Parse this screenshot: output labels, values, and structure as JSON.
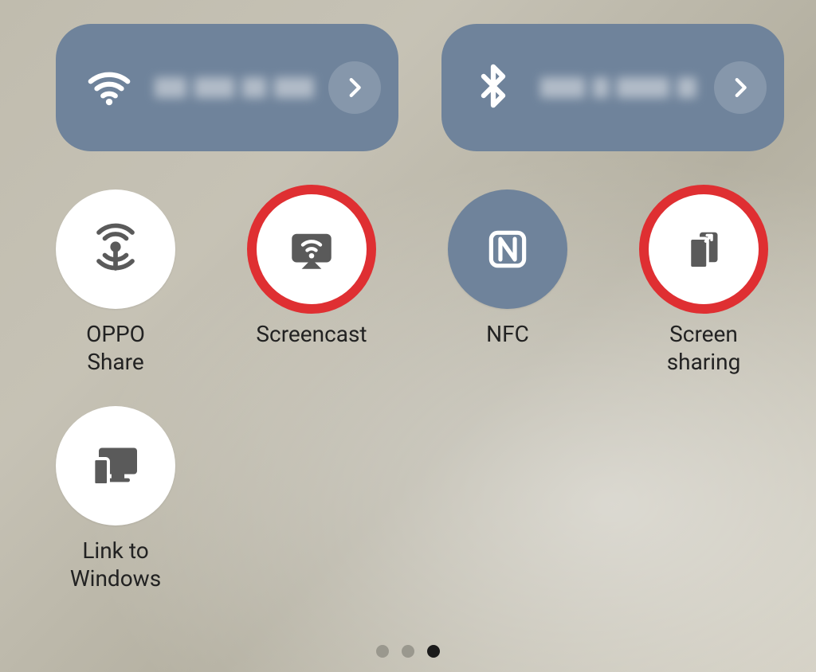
{
  "pills": {
    "wifi": {
      "icon": "wifi-icon"
    },
    "bluetooth": {
      "icon": "bluetooth-icon"
    }
  },
  "tiles": {
    "oppo_share": {
      "label": "OPPO Share"
    },
    "screencast": {
      "label": "Screencast"
    },
    "nfc": {
      "label": "NFC"
    },
    "screen_sharing": {
      "label": "Screen\nsharing"
    },
    "link_windows": {
      "label": "Link to\nWindows"
    }
  },
  "highlight_color": "#df2f32",
  "active_tile_bg": "#6f839b",
  "page_indicator": {
    "count": 3,
    "current": 3
  }
}
